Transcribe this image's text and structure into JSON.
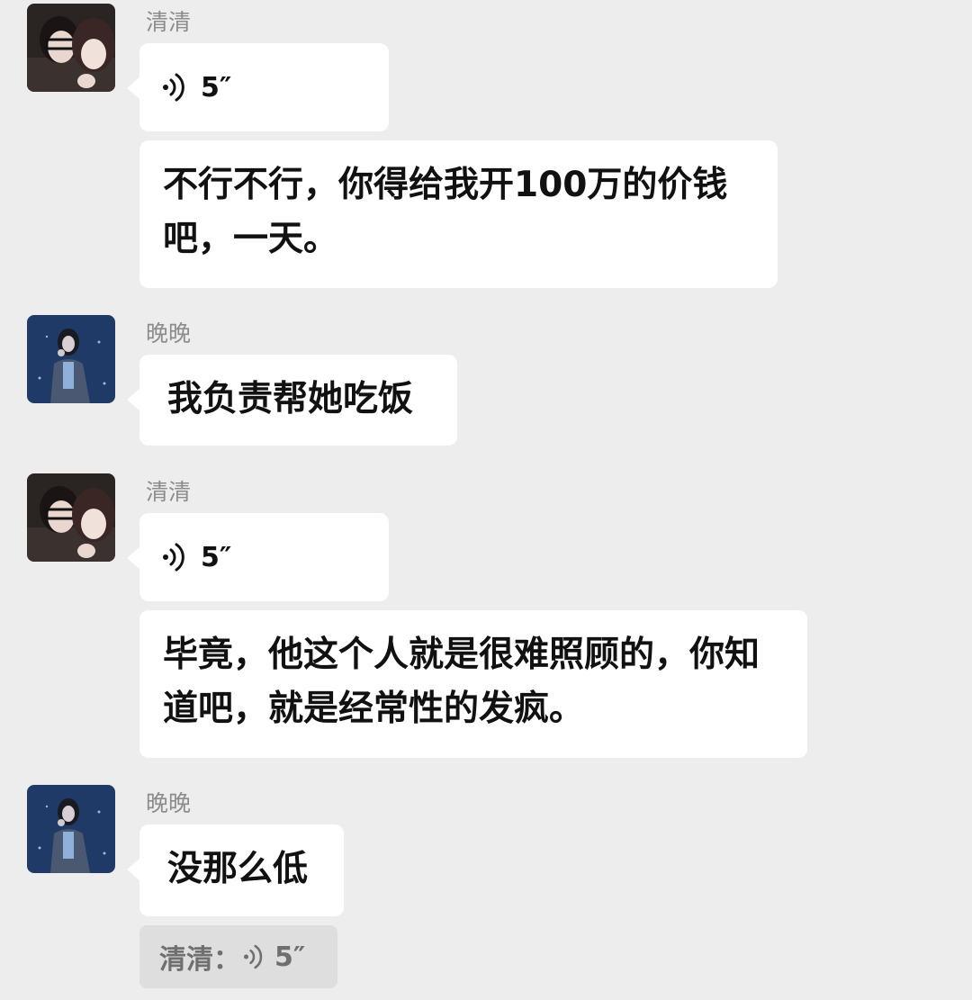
{
  "messages": [
    {
      "sender": "清清",
      "avatar": "couple-photo-avatar",
      "type": "voice",
      "duration": "5″"
    },
    {
      "sender": "清清",
      "type": "text",
      "text": "不行不行，你得给我开100万的价钱吧，一天。"
    },
    {
      "sender": "晚晚",
      "avatar": "singer-photo-avatar",
      "type": "text",
      "text": "我负责帮她吃饭"
    },
    {
      "sender": "清清",
      "avatar": "couple-photo-avatar",
      "type": "voice",
      "duration": "5″"
    },
    {
      "sender": "清清",
      "type": "text",
      "text": "毕竟，他这个人就是很难照顾的，你知道吧，就是经常性的发疯。"
    },
    {
      "sender": "晚晚",
      "avatar": "singer-photo-avatar",
      "type": "text",
      "text": "没那么低"
    }
  ],
  "quote": {
    "sender": "清清：",
    "type": "voice",
    "duration": "5″",
    "icon": "voice-icon"
  },
  "colors": {
    "background": "#ededed",
    "bubble": "#ffffff",
    "quote_bg": "#dedede",
    "name": "#8c8c8c"
  }
}
